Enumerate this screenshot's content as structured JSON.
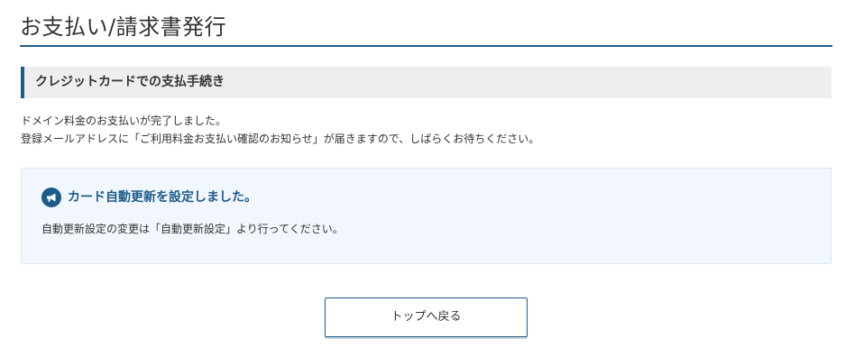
{
  "page": {
    "title": "お支払い/請求書発行"
  },
  "section": {
    "heading": "クレジットカードでの支払手続き"
  },
  "message": {
    "line1": "ドメイン料金のお支払いが完了しました。",
    "line2": "登録メールアドレスに「ご利用料金お支払い確認のお知らせ」が届きますので、しばらくお待ちください。"
  },
  "notice": {
    "icon": "megaphone-icon",
    "title": "カード自動更新を設定しました。",
    "body": "自動更新設定の変更は「自動更新設定」より行ってください。"
  },
  "actions": {
    "back_to_top_label": "トップへ戻る"
  },
  "colors": {
    "accent": "#1d5b8a",
    "notice_bg": "#f1f7fd",
    "section_bg": "#eeeeee"
  }
}
